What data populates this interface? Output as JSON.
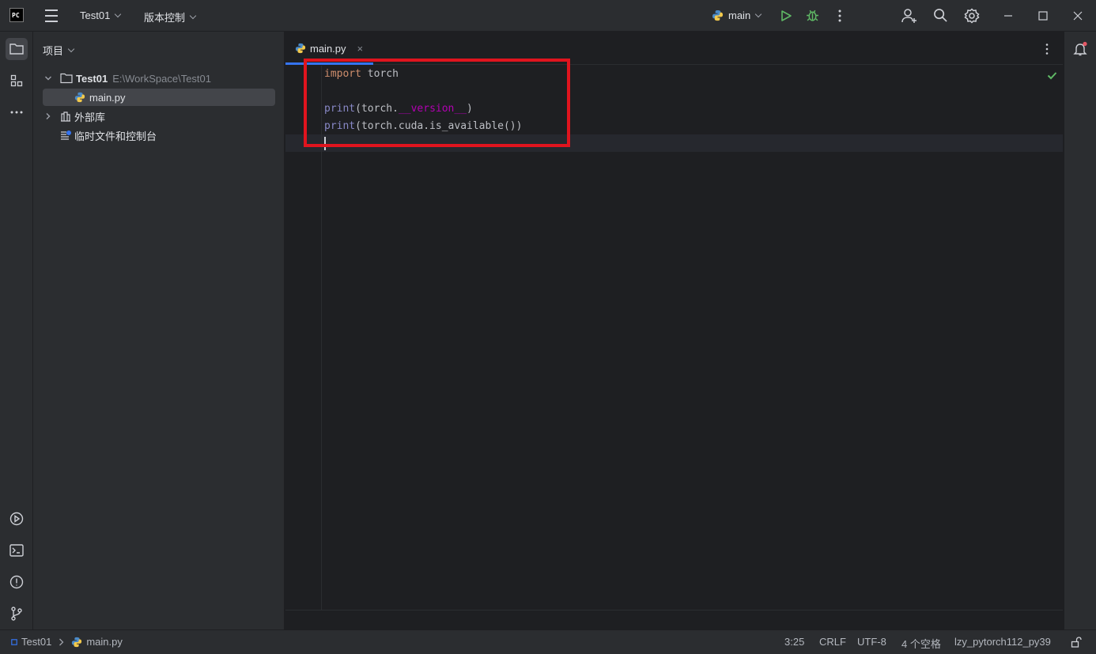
{
  "titlebar": {
    "logo_text": "PC",
    "project_menu": "Test01",
    "vcs_menu": "版本控制",
    "run_config": "main",
    "icons": [
      "menu-icon",
      "python-icon",
      "run-icon",
      "debug-icon",
      "more-icon",
      "add-user-icon",
      "search-icon",
      "settings-icon",
      "minimize-icon",
      "maximize-icon",
      "close-icon"
    ]
  },
  "left_strip": {
    "icons": [
      "project-icon",
      "structure-icon",
      "more-tools-icon",
      "run-tool-icon",
      "terminal-icon",
      "problems-icon",
      "git-icon"
    ]
  },
  "project_panel": {
    "title": "项目",
    "tree": [
      {
        "label": "Test01",
        "path": "E:\\WorkSpace\\Test01",
        "expanded": true
      },
      {
        "label": "main.py",
        "selected": true
      },
      {
        "label": "外部库",
        "expanded": false
      },
      {
        "label": "临时文件和控制台"
      }
    ]
  },
  "editor": {
    "tab": {
      "label": "main.py",
      "close": "×"
    },
    "code": {
      "line1": {
        "kw": "import",
        "rest": " torch"
      },
      "line3": {
        "fn": "print",
        "a": "(torch.",
        "dunder": "__version__",
        "b": ")"
      },
      "line4": {
        "fn": "print",
        "a": "(torch.cuda.is_available())"
      }
    },
    "status_ok": true
  },
  "statusbar": {
    "breadcrumb_project": "Test01",
    "breadcrumb_file": "main.py",
    "position": "3:25",
    "line_ending": "CRLF",
    "encoding": "UTF-8",
    "indent": "4 个空格",
    "interpreter": "lzy_pytorch112_py39"
  },
  "colors": {
    "accent": "#3574f0",
    "highlight_box": "#e0141e",
    "keyword": "#cf8e6d",
    "builtin": "#8888c6",
    "dunder": "#b200b2",
    "run_green": "#5fb865"
  }
}
